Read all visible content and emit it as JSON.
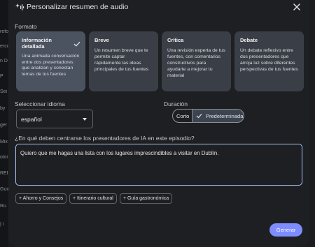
{
  "background": {
    "items": [
      "refo",
      "ercc",
      "n D",
      "P",
      "Sei",
      "by",
      "ger",
      "Mix",
      "olor",
      "REL",
      "Guid",
      "Ru",
      "| i"
    ]
  },
  "dialog": {
    "title": "Personalizar resumen de audio",
    "icons": {
      "title_icon": "audio-sparkle-icon",
      "close_icon": "close-icon"
    }
  },
  "formato": {
    "label": "Formato",
    "cards": [
      {
        "title": "Información detallada",
        "description": "Una animada conversación entre dos presentadores que analizan y conectan temas de tus fuentes",
        "selected": true
      },
      {
        "title": "Breve",
        "description": "Un resumen breve que te permite captar rápidamente las ideas principales de tus fuentes",
        "selected": false
      },
      {
        "title": "Crítica",
        "description": "Una revisión experta de tus fuentes, con comentarios constructivos para ayudarte a mejorar tu material",
        "selected": false
      },
      {
        "title": "Debate",
        "description": "Un debate reflexivo entre dos presentadores que arroja luz sobre diferentes perspectivas de tus fuentes",
        "selected": false
      }
    ]
  },
  "idioma": {
    "label": "Seleccionar idioma",
    "value": "español"
  },
  "duracion": {
    "label": "Duración",
    "options": [
      "Corto",
      "Predeterminada"
    ],
    "selected": "Predeterminada"
  },
  "prompt": {
    "label": "¿En qué deben centrarse los presentadores de IA en este episodio?",
    "value": "Quiero que me hagas una lista con los lugares imprescindibles a visitar en Dublín."
  },
  "chips": [
    "+ Ahorro y Consejos",
    "+ Itinerario cultural",
    "+ Guía gastronómica"
  ],
  "actions": {
    "generar": "Generar"
  },
  "colors": {
    "accent": "#7d8cff",
    "focus_border": "#a8c7fa",
    "selected_card": "#4b5260",
    "card": "#3a3f47"
  }
}
